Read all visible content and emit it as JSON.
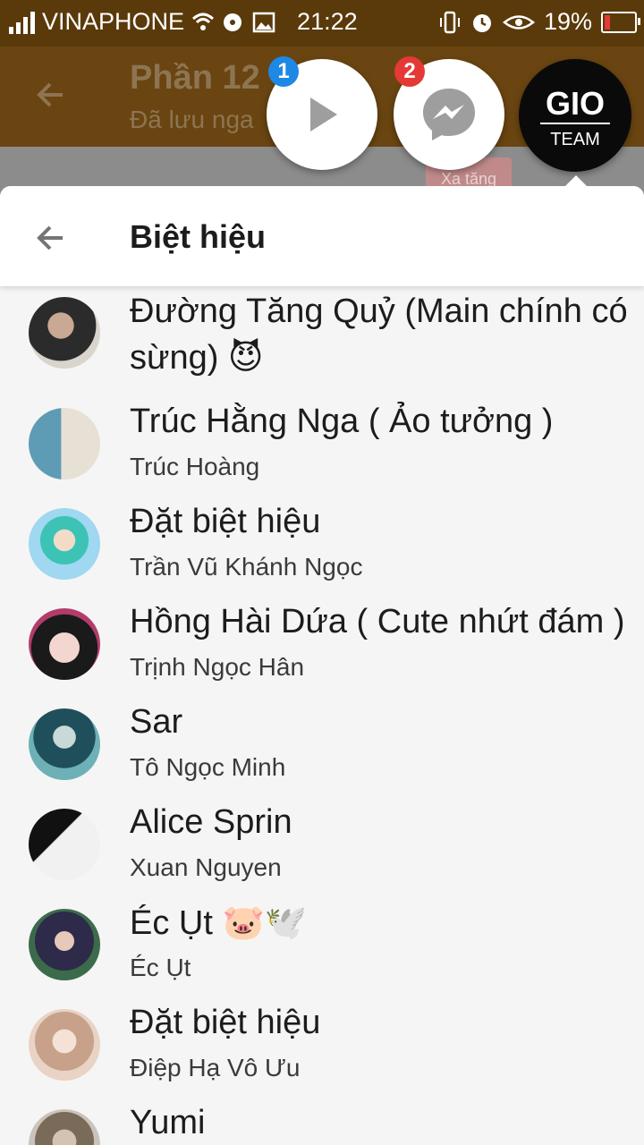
{
  "status_bar": {
    "carrier": "VINAPHONE",
    "time": "21:22",
    "battery": "19%",
    "battery_fraction": 0.19,
    "icons": [
      "signal-icon",
      "wifi-icon",
      "media-icon",
      "image-icon",
      "vibrate-icon",
      "alarm-icon",
      "eye-icon",
      "battery-icon"
    ]
  },
  "background_app": {
    "title": "Phần 12",
    "subtitle": "Đã lưu nga",
    "tag": "Xa tăng"
  },
  "chat_heads": [
    {
      "name": "video-head",
      "badge": "1",
      "badge_color": "#1e88e5"
    },
    {
      "name": "messenger-head",
      "badge": "2",
      "badge_color": "#e53935"
    },
    {
      "name": "gio-team-head",
      "logo_text": "GIO",
      "label": "TEAM"
    }
  ],
  "panel": {
    "title": "Biệt hiệu"
  },
  "members": [
    {
      "nickname": "Đường Tăng Quỷ (Main chính có sừng) 😈",
      "real_name": ""
    },
    {
      "nickname": "Trúc Hằng Nga ( Ảo tưởng )",
      "real_name": "Trúc Hoàng"
    },
    {
      "nickname": "Đặt biệt hiệu",
      "real_name": "Trần Vũ Khánh Ngọc"
    },
    {
      "nickname": "Hồng Hài Dứa ( Cute nhứt đám )",
      "real_name": "Trịnh Ngọc Hân"
    },
    {
      "nickname": "Sar",
      "real_name": "Tô Ngọc Minh"
    },
    {
      "nickname": "Alice Sprin",
      "real_name": "Xuan Nguyen"
    },
    {
      "nickname": "Éc Ụt 🐷🕊️",
      "real_name": "Éc Ụt"
    },
    {
      "nickname": "Đặt biệt hiệu",
      "real_name": "Điệp Hạ Vô Ưu"
    },
    {
      "nickname": "Yumi",
      "real_name": ""
    }
  ],
  "colors": {
    "accent": "#0084ff",
    "header_bg": "#6a4511"
  }
}
